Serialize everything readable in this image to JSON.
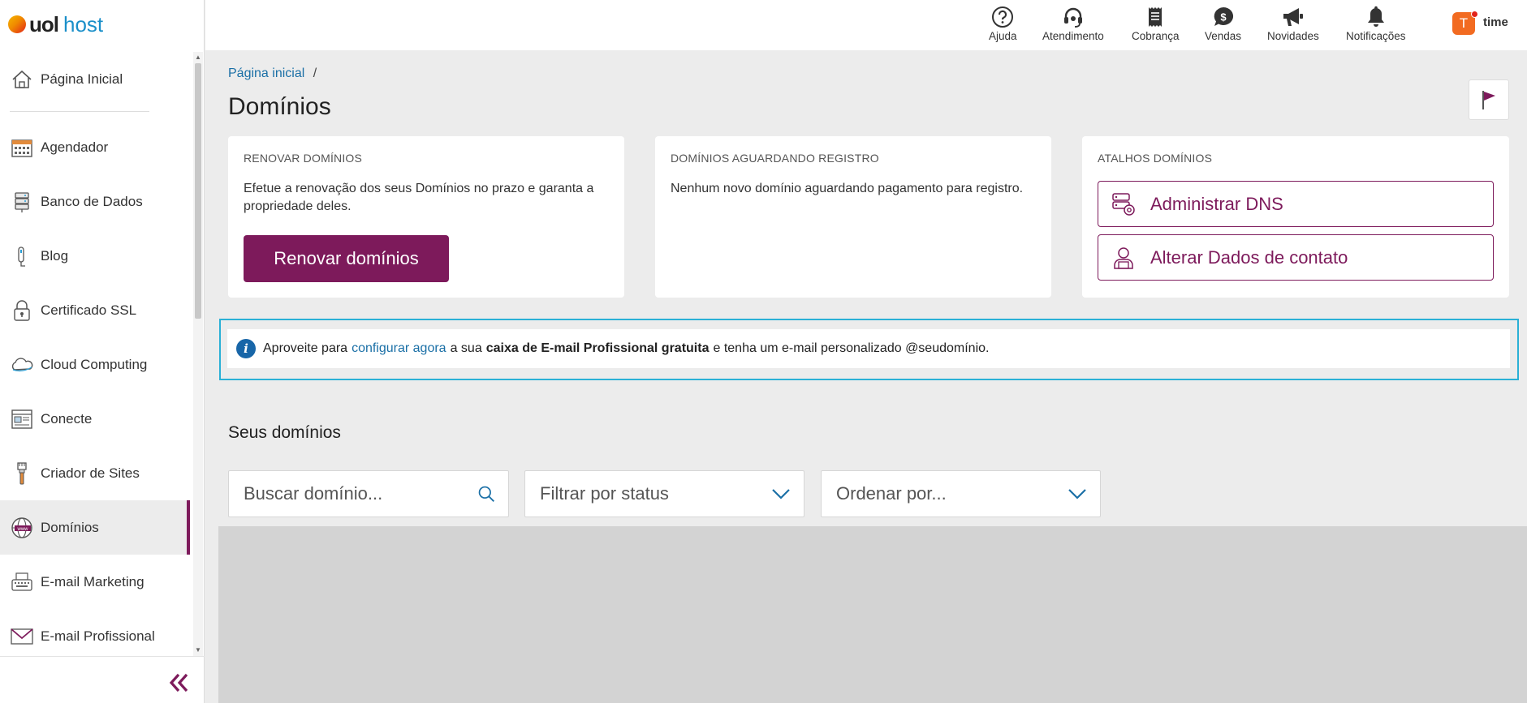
{
  "brand": {
    "name_bold": "uol",
    "name_light": "host"
  },
  "sidebar": {
    "items": [
      {
        "label": "Página Inicial",
        "icon": "home-icon"
      },
      {
        "label": "Agendador",
        "icon": "calendar-icon"
      },
      {
        "label": "Banco de Dados",
        "icon": "database-icon"
      },
      {
        "label": "Blog",
        "icon": "pen-icon"
      },
      {
        "label": "Certificado SSL",
        "icon": "lock-icon"
      },
      {
        "label": "Cloud Computing",
        "icon": "cloud-icon"
      },
      {
        "label": "Conecte",
        "icon": "webpage-icon"
      },
      {
        "label": "Criador de Sites",
        "icon": "brush-icon"
      },
      {
        "label": "Domínios",
        "icon": "globe-www-icon",
        "active": true
      },
      {
        "label": "E-mail Marketing",
        "icon": "typewriter-icon"
      },
      {
        "label": "E-mail Profissional",
        "icon": "envelope-icon"
      }
    ],
    "collapse_icon": "double-chevron-left-icon"
  },
  "topbar": {
    "items": [
      {
        "label": "Ajuda",
        "icon": "help-icon"
      },
      {
        "label": "Atendimento",
        "icon": "headset-icon"
      },
      {
        "label": "Cobrança",
        "icon": "receipt-icon"
      },
      {
        "label": "Vendas",
        "icon": "dollar-chat-icon"
      },
      {
        "label": "Novidades",
        "icon": "megaphone-icon"
      },
      {
        "label": "Notificações",
        "icon": "bell-icon"
      }
    ],
    "user": {
      "initial": "T",
      "name": "time"
    }
  },
  "main": {
    "breadcrumb": {
      "home": "Página inicial",
      "separator": "/"
    },
    "title": "Domínios",
    "cards": {
      "renew": {
        "title": "RENOVAR DOMÍNIOS",
        "text": "Efetue a renovação dos seus Domínios no prazo e garanta a propriedade deles.",
        "button": "Renovar domínios"
      },
      "pending": {
        "title": "DOMÍNIOS AGUARDANDO REGISTRO",
        "text": "Nenhum novo domínio aguardando pagamento para registro."
      },
      "shortcuts": {
        "title": "ATALHOS DOMÍNIOS",
        "dns_button": "Administrar DNS",
        "contact_button": "Alterar Dados de contato"
      }
    },
    "info_banner": {
      "prefix": "Aproveite para",
      "link": "configurar agora",
      "middle": "a sua",
      "bold": "caixa de E-mail Profissional gratuita",
      "suffix": "e tenha um e-mail personalizado @seudomínio."
    },
    "domains_section": {
      "title": "Seus domínios",
      "search_placeholder": "Buscar domínio...",
      "status_filter": "Filtrar por status",
      "order_by": "Ordenar por..."
    }
  },
  "colors": {
    "brand_primary": "#7d1a5b",
    "link": "#1a6fa6",
    "info_border": "#2ab0d6",
    "avatar": "#f26b21"
  }
}
